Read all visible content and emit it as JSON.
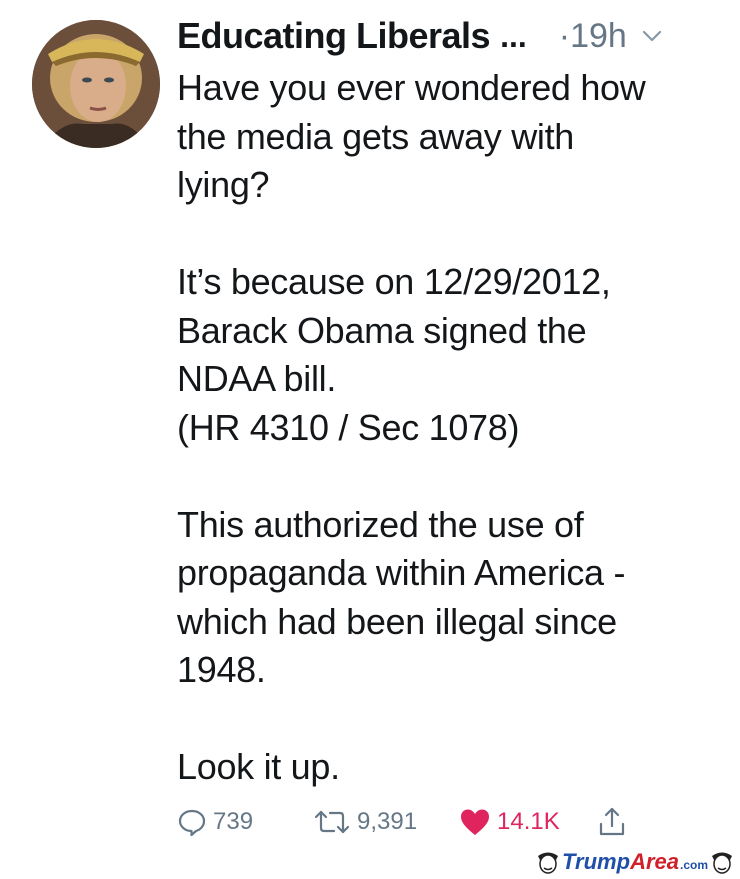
{
  "tweet": {
    "display_name": "Educating Liberals",
    "name_ellipsis": "...",
    "time": "·19h",
    "text": "Have you ever wondered how\nthe media gets away with\nlying?\n\nIt’s because on 12/29/2012,\nBarack Obama signed the\nNDAA bill.\n(HR 4310 / Sec 1078)\n\nThis authorized the use of\npropaganda within America -\nwhich had been illegal since\n1948.\n\nLook it up.",
    "actions": {
      "reply_count": "739",
      "retweet_count": "9,391",
      "like_count": "14.1K"
    }
  },
  "icons": {
    "reply": "speech-bubble-icon",
    "retweet": "retweet-arrows-icon",
    "like": "heart-icon",
    "share": "share-upload-icon",
    "menu": "chevron-down-icon"
  },
  "colors": {
    "text": "#14171a",
    "muted": "#657786",
    "like": "#e0245e"
  },
  "watermark": {
    "brand_part1": "Trump",
    "brand_part2": "Area",
    "brand_suffix": ".com"
  }
}
